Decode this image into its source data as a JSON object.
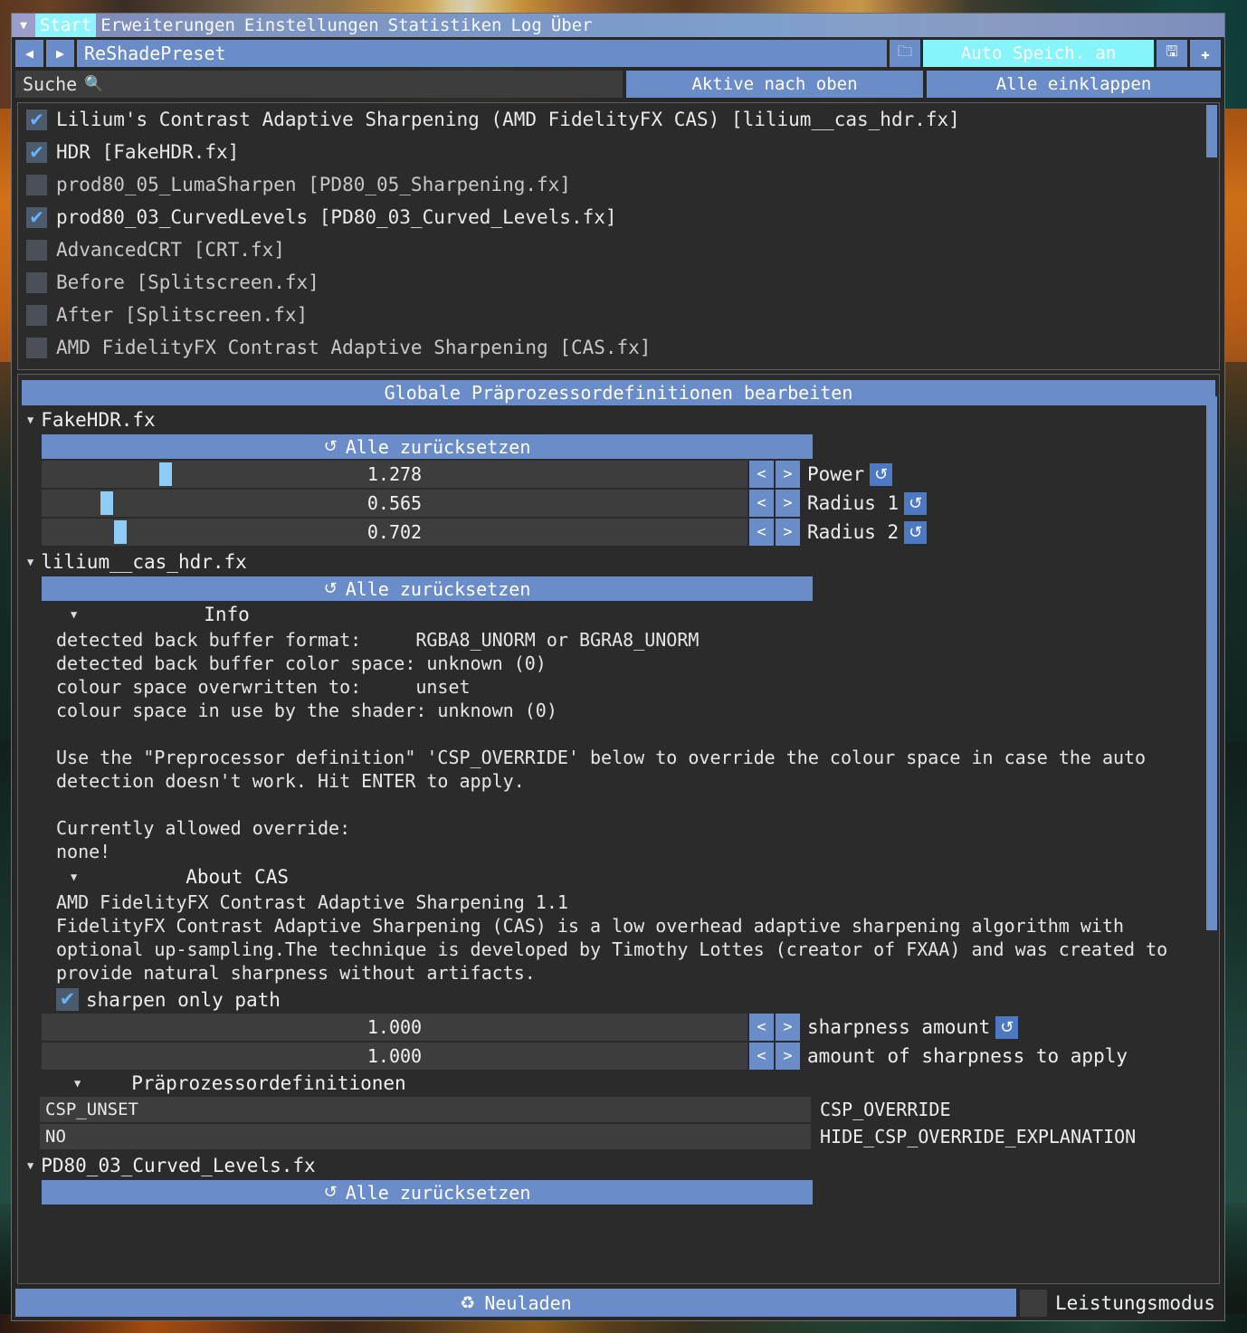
{
  "window": {
    "tabs": [
      {
        "label": "Start",
        "active": true
      },
      {
        "label": "Erweiterungen",
        "active": false
      },
      {
        "label": "Einstellungen",
        "active": false
      },
      {
        "label": "Statistiken",
        "active": false
      },
      {
        "label": "Log",
        "active": false
      },
      {
        "label": "Über",
        "active": false
      }
    ],
    "collapse_icon": "▼"
  },
  "preset": {
    "prev_icon": "◀",
    "next_icon": "▶",
    "value": "ReShadePreset",
    "folder_icon": "🗀",
    "autosave_label": "Auto Speich. an",
    "save_icon": "🖫",
    "add_icon": "✚"
  },
  "search": {
    "placeholder": "Suche",
    "label": "Suche",
    "magnifier_icon": "search-icon",
    "magnifier_glyph": "🔍",
    "active_to_top_label": "Aktive nach oben",
    "collapse_all_label": "Alle einklappen"
  },
  "effects": [
    {
      "label": "Lilium's Contrast Adaptive Sharpening (AMD FidelityFX CAS) [lilium__cas_hdr.fx]",
      "checked": true
    },
    {
      "label": "HDR [FakeHDR.fx]",
      "checked": true
    },
    {
      "label": "prod80_05_LumaSharpen [PD80_05_Sharpening.fx]",
      "checked": false
    },
    {
      "label": "prod80_03_CurvedLevels [PD80_03_Curved_Levels.fx]",
      "checked": true
    },
    {
      "label": "AdvancedCRT [CRT.fx]",
      "checked": false
    },
    {
      "label": "Before [Splitscreen.fx]",
      "checked": false
    },
    {
      "label": "After [Splitscreen.fx]",
      "checked": false
    },
    {
      "label": "AMD FidelityFX Contrast Adaptive Sharpening [CAS.fx]",
      "checked": false
    }
  ],
  "panel": {
    "global_preproc_label": "Globale Präprozessordefinitionen bearbeiten",
    "reset_all_label": "Alle zurücksetzen",
    "reset_icon": "↺",
    "revert_icon": "↺",
    "caret_icon": "▼",
    "fakehdr": {
      "title": "FakeHDR.fx",
      "sliders": [
        {
          "value": "1.278",
          "label": "Power",
          "fill_pct": 17
        },
        {
          "value": "0.565",
          "label": "Radius 1",
          "fill_pct": 8.5
        },
        {
          "value": "0.702",
          "label": "Radius 2",
          "fill_pct": 10.5
        }
      ]
    },
    "cas": {
      "title": "lilium__cas_hdr.fx",
      "info_header": "Info",
      "info_lines": "detected back buffer format:     RGBA8_UNORM or BGRA8_UNORM\ndetected back buffer color space: unknown (0)\ncolour space overwritten to:     unset\ncolour space in use by the shader: unknown (0)",
      "override_text": "Use the \"Preprocessor definition\" 'CSP_OVERRIDE' below to override the colour space in case the auto detection doesn't work. Hit ENTER to apply.",
      "allowed_override_label": "Currently allowed override:",
      "allowed_override_value": "none!",
      "about_header": "About CAS",
      "about_title": "AMD FidelityFX Contrast Adaptive Sharpening 1.1",
      "about_body": "FidelityFX Contrast Adaptive Sharpening (CAS) is a low overhead adaptive sharpening algorithm with optional up-sampling.The technique is developed by Timothy Lottes (creator of FXAA) and was created to provide natural sharpness without artifacts.",
      "sharpen_only_path_label": "sharpen only path",
      "sharpen_only_path_checked": true,
      "sliders": [
        {
          "value": "1.000",
          "label": "sharpness amount",
          "fill_pct": 0,
          "has_revert": true
        },
        {
          "value": "1.000",
          "label": "amount of sharpness to apply",
          "fill_pct": 0,
          "has_revert": false
        }
      ],
      "preproc_header": "Präprozessordefinitionen",
      "definitions": [
        {
          "value": "CSP_UNSET",
          "name": "CSP_OVERRIDE"
        },
        {
          "value": "NO",
          "name": "HIDE_CSP_OVERRIDE_EXPLANATION"
        }
      ]
    },
    "pd80": {
      "title": "PD80_03_Curved_Levels.fx",
      "reset_all_label": "Alle zurücksetzen"
    }
  },
  "footer": {
    "reload_label": "Neuladen",
    "reload_icon": "♻",
    "perf_mode_label": "Leistungsmodus",
    "perf_mode_checked": false
  },
  "colors": {
    "accent_blue": "#6a8cc8",
    "accent_cyan": "#86f4fb",
    "slider_handle": "#8ecbf5",
    "panel_bg": "#2b2b2b",
    "window_bg": "#262626",
    "field_bg": "#3d3d3d",
    "check_blue": "#66b3ff",
    "text": "#e8e8e8"
  }
}
